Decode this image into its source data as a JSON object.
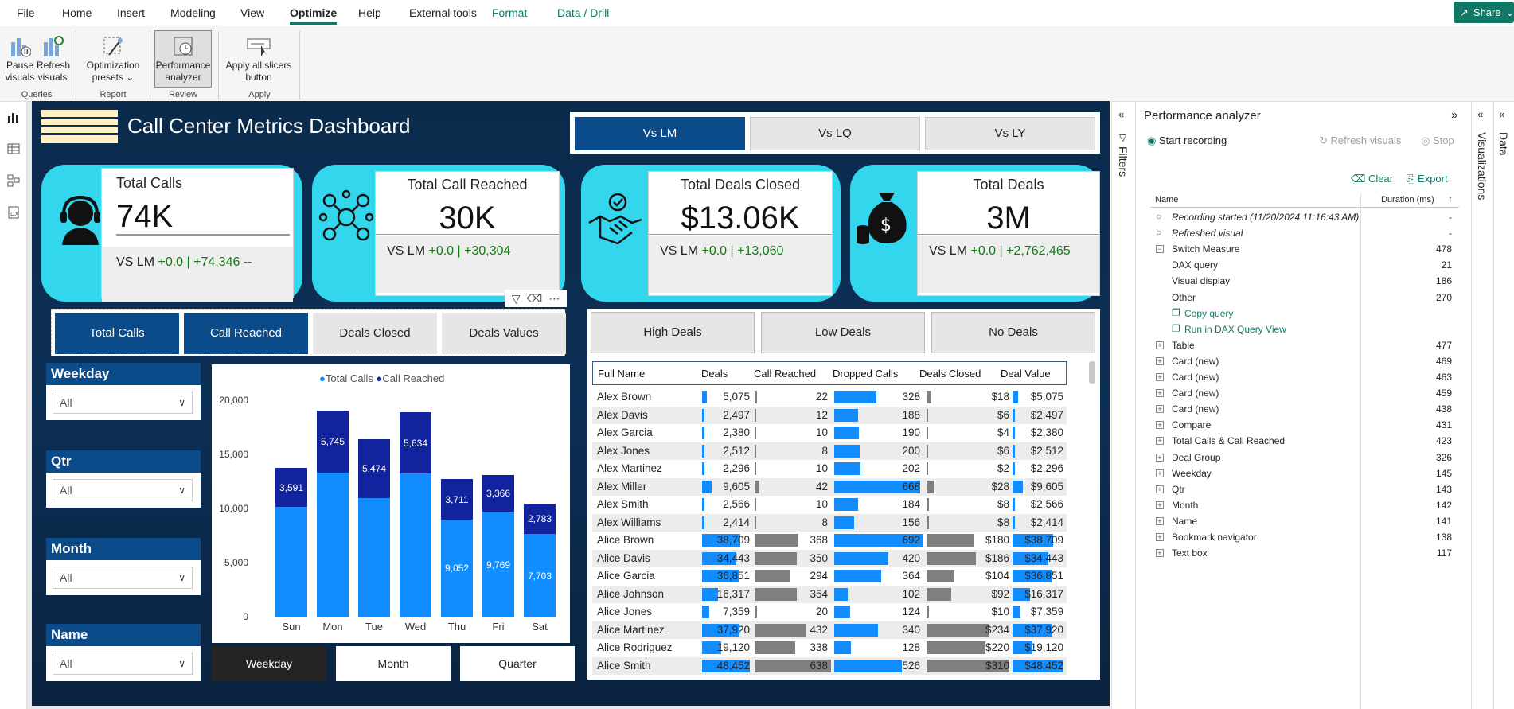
{
  "menu": {
    "items": [
      "File",
      "Home",
      "Insert",
      "Modeling",
      "View",
      "Optimize",
      "Help",
      "External tools",
      "Format",
      "Data / Drill"
    ],
    "active": "Optimize",
    "share_label": "Share"
  },
  "ribbon": {
    "pause_visuals": "Pause visuals",
    "pause_l1": "Pause",
    "pause_l2": "visuals",
    "refresh_l1": "Refresh",
    "refresh_l2": "visuals",
    "presets_l1": "Optimization",
    "presets_l2": "presets ⌄",
    "perf_l1": "Performance",
    "perf_l2": "analyzer",
    "apply_l1": "Apply all slicers",
    "apply_l2": "button",
    "groups": {
      "queries": "Queries",
      "report": "Report",
      "review": "Review",
      "apply": "Apply"
    }
  },
  "report": {
    "title": "Call Center Metrics Dashboard",
    "compare_buttons": [
      "Vs LM",
      "Vs LQ",
      "Vs LY"
    ],
    "compare_selected": "Vs LM",
    "cards": [
      {
        "title": "Total Calls",
        "value": "74K",
        "sub_prefix": "VS LM ",
        "sub_green": "+0.0 | +74,346",
        "sub_suffix": " --",
        "icon": "headset-icon"
      },
      {
        "title": "Total Call Reached",
        "value": "30K",
        "sub_prefix": "VS LM ",
        "sub_green": "+0.0 | +30,304",
        "sub_suffix": "",
        "icon": "network-people-icon"
      },
      {
        "title": "Total Deals Closed",
        "value": "$13.06K",
        "sub_prefix": "VS LM ",
        "sub_green": "+0.0 | +13,060",
        "sub_suffix": "",
        "icon": "handshake-icon"
      },
      {
        "title": "Total Deals",
        "value": "3M",
        "sub_prefix": "VS LM ",
        "sub_green": "+0.0 | +2,762,465",
        "sub_suffix": "",
        "icon": "money-bag-icon"
      }
    ],
    "measure_buttons": [
      "Total Calls",
      "Call Reached",
      "Deals Closed",
      "Deals Values"
    ],
    "measure_selected": [
      "Total Calls",
      "Call Reached"
    ],
    "deal_buttons": [
      "High Deals",
      "Low Deals",
      "No Deals"
    ],
    "slicers": [
      {
        "label": "Weekday",
        "value": "All"
      },
      {
        "label": "Qtr",
        "value": "All"
      },
      {
        "label": "Month",
        "value": "All"
      },
      {
        "label": "Name",
        "value": "All"
      }
    ],
    "bottom_tabs": [
      "Weekday",
      "Month",
      "Quarter"
    ],
    "bottom_selected": "Weekday"
  },
  "chart_data": {
    "type": "bar",
    "stacked": true,
    "categories": [
      "Sun",
      "Mon",
      "Tue",
      "Wed",
      "Thu",
      "Fri",
      "Sat"
    ],
    "series": [
      {
        "name": "Total Calls",
        "values": [
          10200,
          13400,
          11000,
          13300,
          9052,
          9769,
          7703
        ],
        "color": "#118dff"
      },
      {
        "name": "Call Reached",
        "values": [
          3591,
          5745,
          5474,
          5634,
          3711,
          3366,
          2783
        ],
        "color": "#12239e"
      }
    ],
    "data_labels": {
      "Total Calls": [
        "",
        "",
        "",
        "",
        "9,052",
        "9,769",
        "7,703"
      ],
      "Call Reached": [
        "3,591",
        "5,745",
        "5,474",
        "5,634",
        "3,711",
        "3,366",
        "2,783"
      ]
    },
    "y_ticks": [
      "0",
      "5,000",
      "10,000",
      "15,000",
      "20,000"
    ],
    "ylim": [
      0,
      20000
    ],
    "legend": "top-center"
  },
  "table": {
    "columns": [
      "Full Name",
      "Deals",
      "Call Reached",
      "Dropped Calls",
      "Deals Closed",
      "Deal Value"
    ],
    "rows": [
      {
        "name": "Alex Brown",
        "deals": "5,075",
        "reached": "22",
        "dropped": "328",
        "closed": "$18",
        "value": "$5,075",
        "d": 5075,
        "r": 22,
        "p": 328,
        "c": 18
      },
      {
        "name": "Alex Davis",
        "deals": "2,497",
        "reached": "12",
        "dropped": "188",
        "closed": "$6",
        "value": "$2,497",
        "d": 2497,
        "r": 12,
        "p": 188,
        "c": 6
      },
      {
        "name": "Alex Garcia",
        "deals": "2,380",
        "reached": "10",
        "dropped": "190",
        "closed": "$4",
        "value": "$2,380",
        "d": 2380,
        "r": 10,
        "p": 190,
        "c": 4
      },
      {
        "name": "Alex Jones",
        "deals": "2,512",
        "reached": "8",
        "dropped": "200",
        "closed": "$6",
        "value": "$2,512",
        "d": 2512,
        "r": 8,
        "p": 200,
        "c": 6
      },
      {
        "name": "Alex Martinez",
        "deals": "2,296",
        "reached": "10",
        "dropped": "202",
        "closed": "$2",
        "value": "$2,296",
        "d": 2296,
        "r": 10,
        "p": 202,
        "c": 2
      },
      {
        "name": "Alex Miller",
        "deals": "9,605",
        "reached": "42",
        "dropped": "668",
        "closed": "$28",
        "value": "$9,605",
        "d": 9605,
        "r": 42,
        "p": 668,
        "c": 28
      },
      {
        "name": "Alex Smith",
        "deals": "2,566",
        "reached": "10",
        "dropped": "184",
        "closed": "$8",
        "value": "$2,566",
        "d": 2566,
        "r": 10,
        "p": 184,
        "c": 8
      },
      {
        "name": "Alex Williams",
        "deals": "2,414",
        "reached": "8",
        "dropped": "156",
        "closed": "$8",
        "value": "$2,414",
        "d": 2414,
        "r": 8,
        "p": 156,
        "c": 8
      },
      {
        "name": "Alice Brown",
        "deals": "38,709",
        "reached": "368",
        "dropped": "692",
        "closed": "$180",
        "value": "$38,709",
        "d": 38709,
        "r": 368,
        "p": 692,
        "c": 180
      },
      {
        "name": "Alice Davis",
        "deals": "34,443",
        "reached": "350",
        "dropped": "420",
        "closed": "$186",
        "value": "$34,443",
        "d": 34443,
        "r": 350,
        "p": 420,
        "c": 186
      },
      {
        "name": "Alice Garcia",
        "deals": "36,851",
        "reached": "294",
        "dropped": "364",
        "closed": "$104",
        "value": "$36,851",
        "d": 36851,
        "r": 294,
        "p": 364,
        "c": 104
      },
      {
        "name": "Alice Johnson",
        "deals": "16,317",
        "reached": "354",
        "dropped": "102",
        "closed": "$92",
        "value": "$16,317",
        "d": 16317,
        "r": 354,
        "p": 102,
        "c": 92
      },
      {
        "name": "Alice Jones",
        "deals": "7,359",
        "reached": "20",
        "dropped": "124",
        "closed": "$10",
        "value": "$7,359",
        "d": 7359,
        "r": 20,
        "p": 124,
        "c": 10
      },
      {
        "name": "Alice Martinez",
        "deals": "37,920",
        "reached": "432",
        "dropped": "340",
        "closed": "$234",
        "value": "$37,920",
        "d": 37920,
        "r": 432,
        "p": 340,
        "c": 234
      },
      {
        "name": "Alice Rodriguez",
        "deals": "19,120",
        "reached": "338",
        "dropped": "128",
        "closed": "$220",
        "value": "$19,120",
        "d": 19120,
        "r": 338,
        "p": 128,
        "c": 220
      },
      {
        "name": "Alice Smith",
        "deals": "48,452",
        "reached": "638",
        "dropped": "526",
        "closed": "$310",
        "value": "$48,452",
        "d": 48452,
        "r": 638,
        "p": 526,
        "c": 310
      }
    ]
  },
  "filters_label": "Filters",
  "visualizations_label": "Visualizations",
  "data_label": "Data",
  "perf": {
    "title": "Performance analyzer",
    "start_recording": "Start recording",
    "refresh_visuals": "Refresh visuals",
    "stop": "Stop",
    "clear": "Clear",
    "export": "Export",
    "col_name": "Name",
    "col_duration": "Duration (ms)",
    "rows": [
      {
        "name": "Recording started (11/20/2024 11:16:43 AM)",
        "duration": "-",
        "kind": "info"
      },
      {
        "name": "Refreshed visual",
        "duration": "-",
        "kind": "info"
      },
      {
        "name": "Switch Measure",
        "duration": "478",
        "kind": "expanded"
      },
      {
        "name": "DAX query",
        "duration": "21",
        "kind": "child"
      },
      {
        "name": "Visual display",
        "duration": "186",
        "kind": "child"
      },
      {
        "name": "Other",
        "duration": "270",
        "kind": "child"
      },
      {
        "name": "Copy query",
        "duration": "",
        "kind": "link"
      },
      {
        "name": "Run in DAX Query View",
        "duration": "",
        "kind": "link"
      },
      {
        "name": "Table",
        "duration": "477",
        "kind": "collapsed"
      },
      {
        "name": "Card (new)",
        "duration": "469",
        "kind": "collapsed"
      },
      {
        "name": "Card (new)",
        "duration": "463",
        "kind": "collapsed"
      },
      {
        "name": "Card (new)",
        "duration": "459",
        "kind": "collapsed"
      },
      {
        "name": "Card (new)",
        "duration": "438",
        "kind": "collapsed"
      },
      {
        "name": "Compare",
        "duration": "431",
        "kind": "collapsed"
      },
      {
        "name": "Total Calls & Call Reached",
        "duration": "423",
        "kind": "collapsed"
      },
      {
        "name": "Deal Group",
        "duration": "326",
        "kind": "collapsed"
      },
      {
        "name": "Weekday",
        "duration": "145",
        "kind": "collapsed"
      },
      {
        "name": "Qtr",
        "duration": "143",
        "kind": "collapsed"
      },
      {
        "name": "Month",
        "duration": "142",
        "kind": "collapsed"
      },
      {
        "name": "Name",
        "duration": "141",
        "kind": "collapsed"
      },
      {
        "name": "Bookmark navigator",
        "duration": "138",
        "kind": "collapsed"
      },
      {
        "name": "Text box",
        "duration": "117",
        "kind": "collapsed"
      }
    ]
  }
}
